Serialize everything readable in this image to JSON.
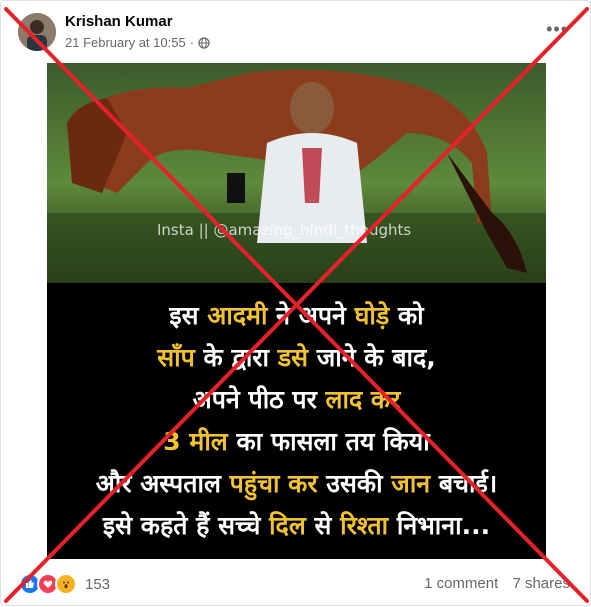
{
  "post": {
    "author": "Krishan Kumar",
    "timestamp": "21 February at 10:55",
    "privacy_icon": "globe-icon",
    "more_icon": "more-options-icon",
    "more_label": "•••"
  },
  "image": {
    "watermark": "Insta || @amazing_hindi_thoughts",
    "caption_lines": [
      [
        {
          "t": "इस ",
          "c": "w"
        },
        {
          "t": "आदमी ",
          "c": "y"
        },
        {
          "t": "ने अपने ",
          "c": "w"
        },
        {
          "t": "घोड़े ",
          "c": "y"
        },
        {
          "t": "को",
          "c": "w"
        }
      ],
      [
        {
          "t": "साँप ",
          "c": "y"
        },
        {
          "t": "के द्वारा ",
          "c": "w"
        },
        {
          "t": "डसे ",
          "c": "y"
        },
        {
          "t": "जाने के बाद,",
          "c": "w"
        }
      ],
      [
        {
          "t": "अपने पीठ पर ",
          "c": "w"
        },
        {
          "t": "लाद कर",
          "c": "y"
        }
      ],
      [
        {
          "t": "3 मील ",
          "c": "y"
        },
        {
          "t": "का फासला तय किया",
          "c": "w"
        }
      ],
      [
        {
          "t": "और अस्पताल ",
          "c": "w"
        },
        {
          "t": "पहुंचा कर ",
          "c": "y"
        },
        {
          "t": "उसकी ",
          "c": "w"
        },
        {
          "t": "जान ",
          "c": "y"
        },
        {
          "t": "बचाई।",
          "c": "w"
        }
      ],
      [
        {
          "t": "इसे कहते हैं सच्चे ",
          "c": "w"
        },
        {
          "t": "दिल ",
          "c": "y"
        },
        {
          "t": "से ",
          "c": "w"
        },
        {
          "t": "रिश्ता ",
          "c": "y"
        },
        {
          "t": "निभाना...",
          "c": "w"
        }
      ]
    ]
  },
  "footer": {
    "reaction_icons": [
      "like-icon",
      "love-icon",
      "wow-icon"
    ],
    "reaction_count": "153",
    "comments": "1 comment",
    "shares": "7 shares"
  },
  "overlay": {
    "cross_color": "#e8202a"
  }
}
